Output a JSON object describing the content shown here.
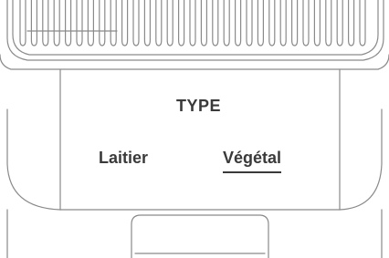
{
  "panel": {
    "heading": "TYPE",
    "options": [
      {
        "label": "Laitier",
        "selected": false
      },
      {
        "label": "Végétal",
        "selected": true
      }
    ]
  },
  "colors": {
    "stroke": "#8a8a8a",
    "text": "#3a3a3a",
    "background": "#ffffff"
  }
}
